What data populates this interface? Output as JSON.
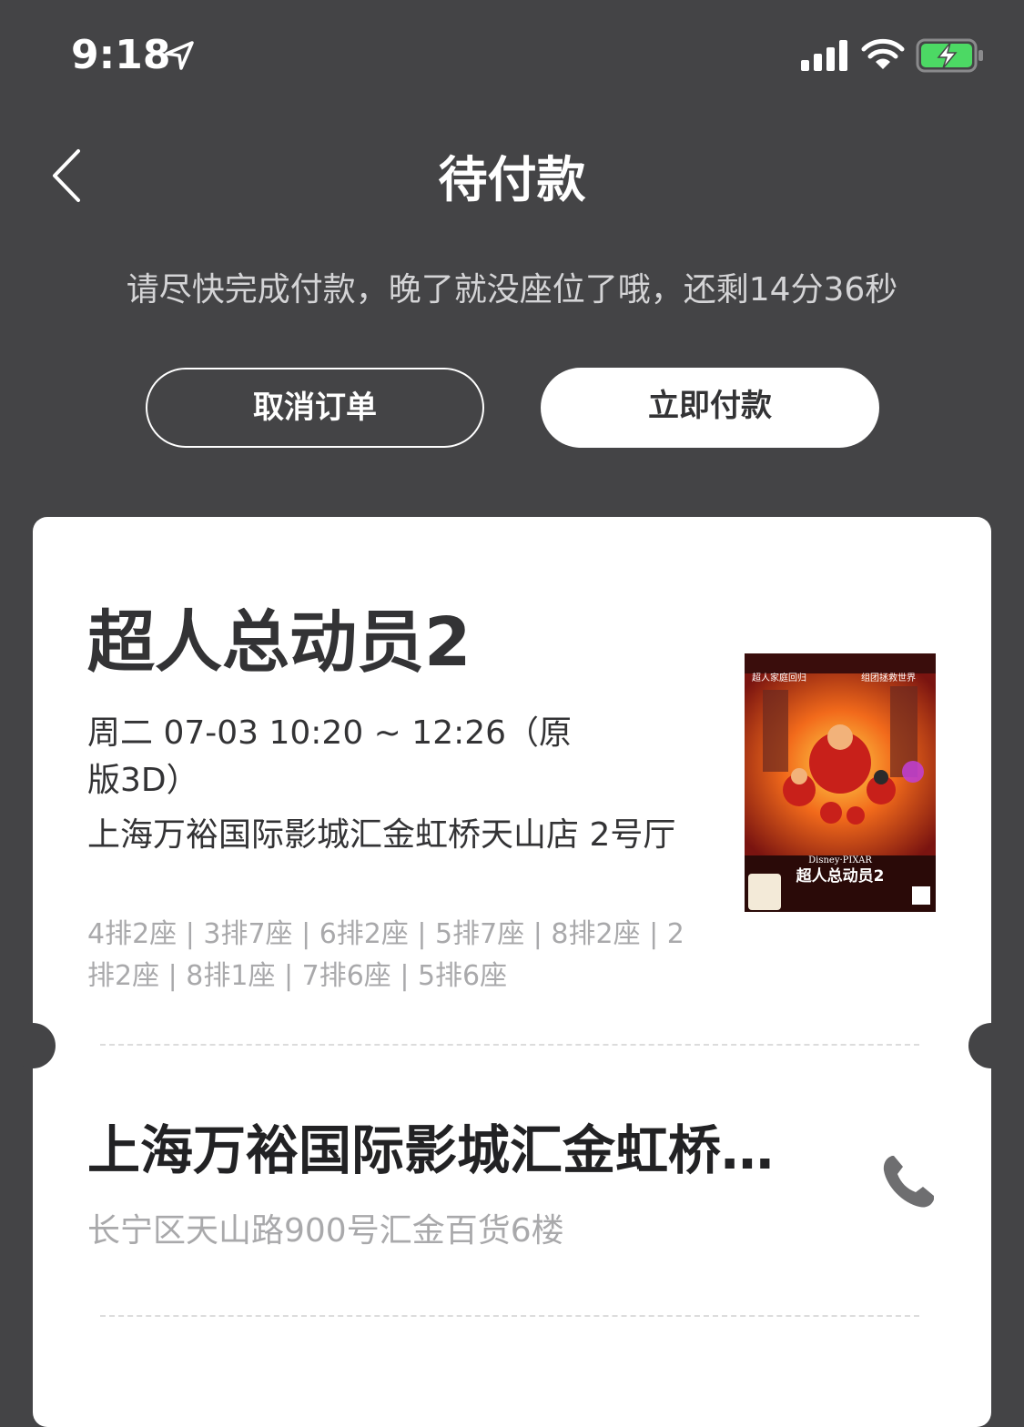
{
  "status_bar": {
    "time": "9:18",
    "icons": [
      "location-arrow-icon",
      "cellular-signal-icon",
      "wifi-icon",
      "battery-charging-icon"
    ],
    "battery_color": "#4cd964"
  },
  "header": {
    "back_icon": "chevron-left-icon",
    "title": "待付款"
  },
  "notice": {
    "countdown_text": "请尽快完成付款，晚了就没座位了哦，还剩14分36秒"
  },
  "actions": {
    "cancel_label": "取消订单",
    "pay_label": "立即付款"
  },
  "ticket": {
    "movie_title": "超人总动员2",
    "showtime": "周二 07-03 10:20 ~ 12:26（原版3D）",
    "cinema_hall": "上海万裕国际影城汇金虹桥天山店 2号厅",
    "seats": "4排2座 | 3排7座 | 6排2座 | 5排7座 | 8排2座 | 2排2座 | 8排1座 | 7排6座 | 5排6座",
    "poster": {
      "top_left_text": "超人家庭回归",
      "top_right_text": "组团拯救世界",
      "brand_text": "Disney·PIXAR",
      "title_text": "超人总动员2"
    }
  },
  "cinema": {
    "name": "上海万裕国际影城汇金虹桥天山店",
    "address": "长宁区天山路900号汇金百货6楼",
    "phone_icon": "phone-icon"
  },
  "colors": {
    "background": "#444446",
    "card": "#ffffff",
    "primary_text": "#333335",
    "secondary_text": "#a9a9ab"
  }
}
